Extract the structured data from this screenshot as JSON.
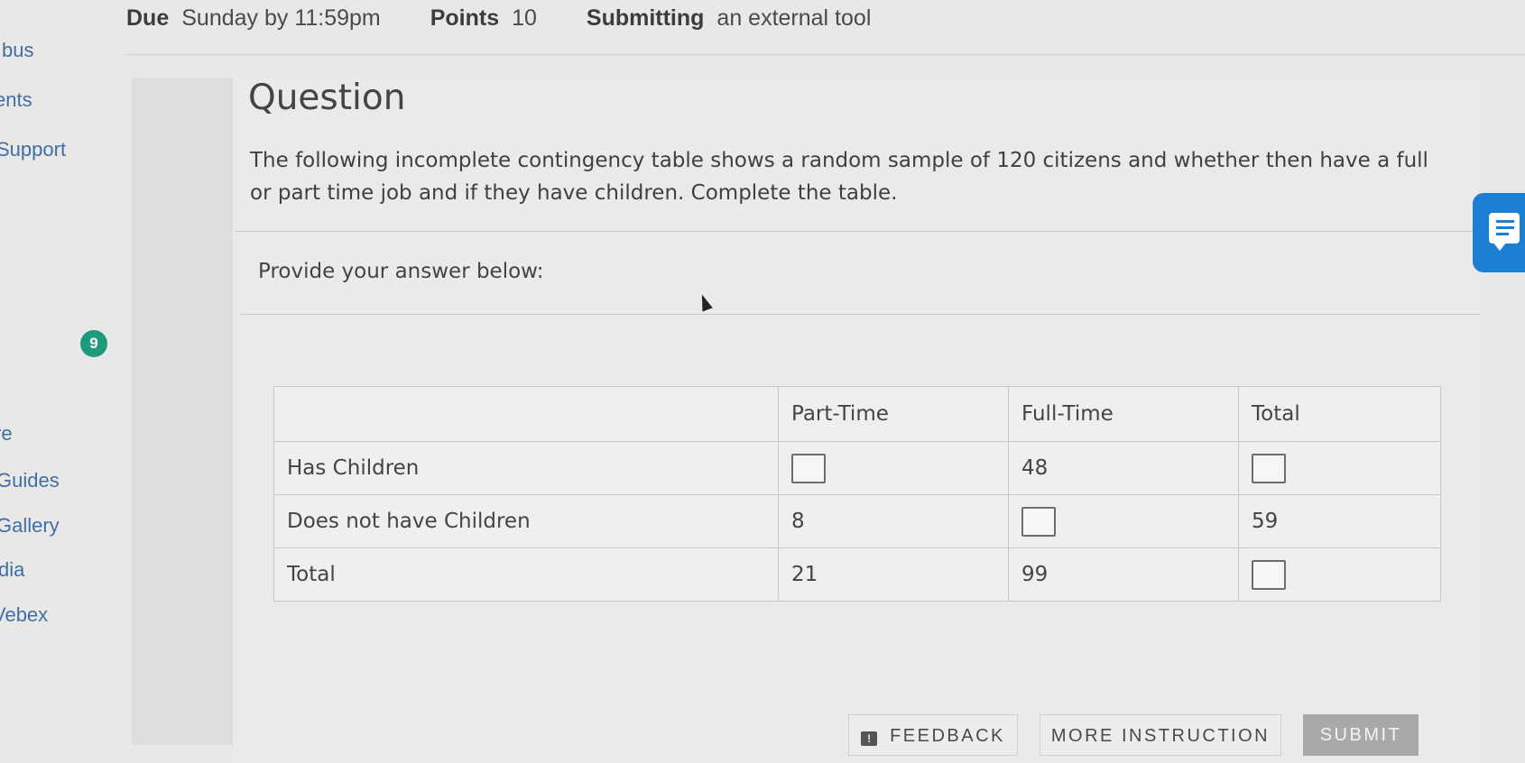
{
  "header": {
    "due_label": "Due",
    "due_value": "Sunday by 11:59pm",
    "points_label": "Points",
    "points_value": "10",
    "submitting_label": "Submitting",
    "submitting_value": "an external tool"
  },
  "sidebar": {
    "items": [
      "bus",
      "ents",
      "Support",
      "re",
      "Guides",
      "Gallery",
      "dia",
      "Vebex"
    ],
    "badge": "9"
  },
  "question": {
    "title": "Question",
    "text": "The following incomplete contingency table shows a random sample of 120 citizens and whether then have a full or part time job and if they have children. Complete the table.",
    "provide": "Provide your answer below:"
  },
  "table": {
    "headers": [
      "",
      "Part-Time",
      "Full-Time",
      "Total"
    ],
    "rows": [
      {
        "label": "Has Children",
        "part": "",
        "full": "48",
        "total": ""
      },
      {
        "label": "Does not have Children",
        "part": "8",
        "full": "",
        "total": "59"
      },
      {
        "label": "Total",
        "part": "21",
        "full": "99",
        "total": ""
      }
    ]
  },
  "buttons": {
    "feedback": "FEEDBACK",
    "more": "MORE INSTRUCTION",
    "submit": "SUBMIT"
  },
  "colors": {
    "link": "#3f6fa8",
    "badge": "#1f9a7c",
    "chat": "#1d7fd1",
    "submit": "#a9a9a7"
  },
  "icons": [
    "feedback-icon",
    "chat-icon",
    "mouse-cursor-icon"
  ]
}
